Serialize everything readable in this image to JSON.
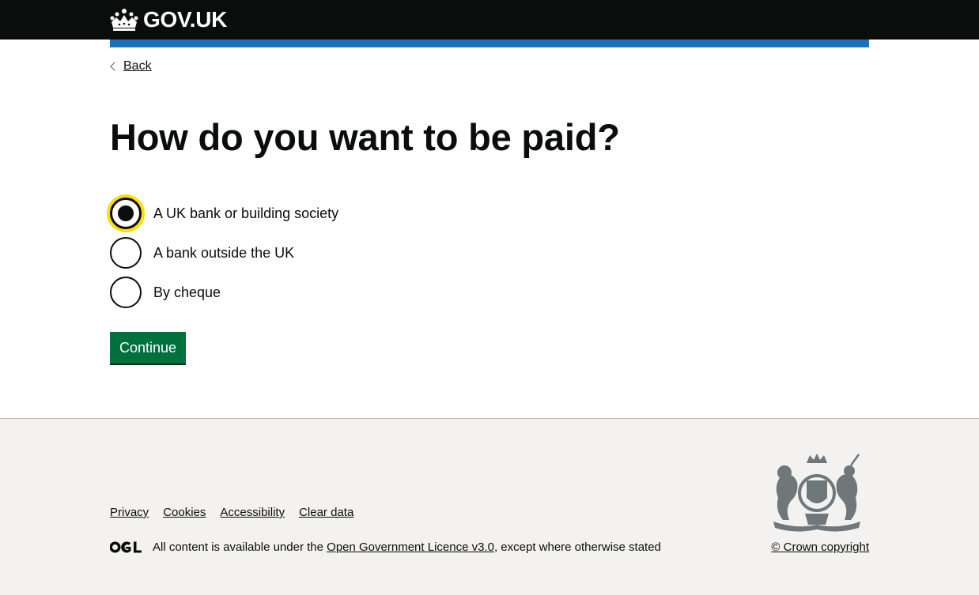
{
  "header": {
    "logo_text": "GOV.UK",
    "bg_color": "#0b0c0c",
    "bar_color": "#1d70b8",
    "logo_icon": "crown-icon"
  },
  "back_link": {
    "label": "Back",
    "icon": "chevron-left-icon"
  },
  "page_title": "How do you want to be paid?",
  "payment_options": [
    {
      "label": "A UK bank or building society",
      "checked": true,
      "focused": true
    },
    {
      "label": "A bank outside the UK",
      "checked": false,
      "focused": false
    },
    {
      "label": "By cheque",
      "checked": false,
      "focused": false
    }
  ],
  "continue_button": {
    "label": "Continue",
    "color": "#00703c"
  },
  "footer": {
    "links": [
      "Privacy",
      "Cookies",
      "Accessibility",
      "Clear data"
    ],
    "licence": {
      "prefix": "All content is available under the",
      "link_text": "Open Government Licence v3.0",
      "suffix": ", except where otherwise stated",
      "logo_icon": "ogl-logo-icon"
    },
    "crest_icon": "royal-coat-of-arms-icon",
    "copyright": "© Crown copyright"
  }
}
